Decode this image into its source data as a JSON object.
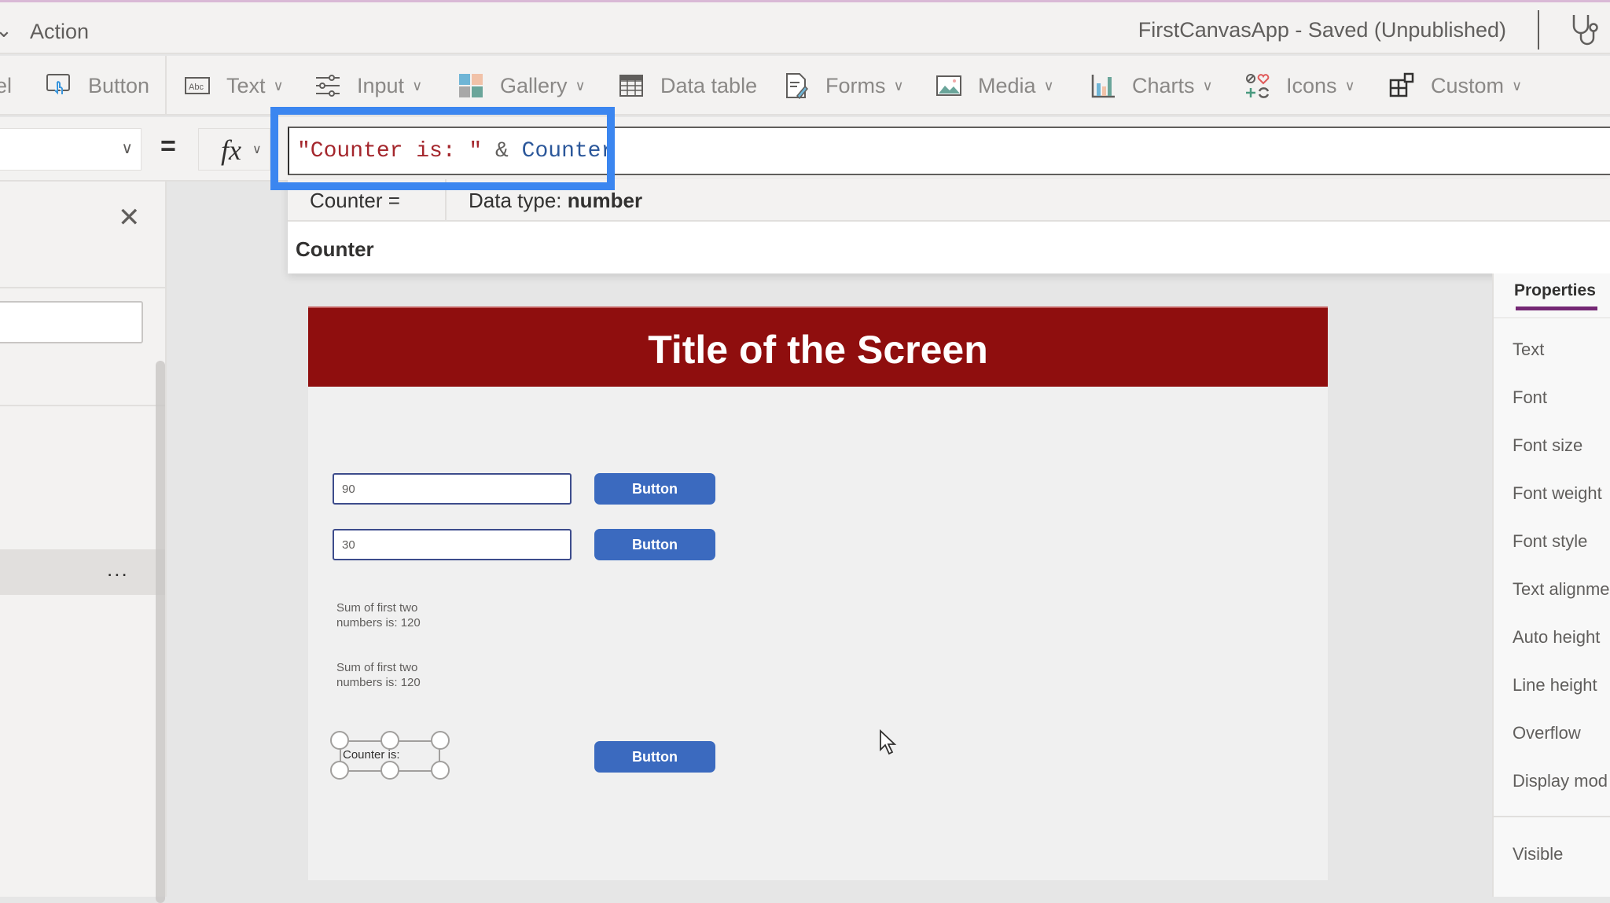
{
  "titlebar": {
    "menu_label": "Action",
    "app_status": "FirstCanvasApp - Saved (Unpublished)",
    "app_checker_icon": "stethoscope-icon"
  },
  "toolbar": {
    "items": [
      {
        "label": "el",
        "icon": "label-icon",
        "has_chevron": false
      },
      {
        "label": "Button",
        "icon": "button-icon",
        "has_chevron": false
      },
      {
        "label": "Text",
        "icon": "text-abc-icon",
        "has_chevron": true
      },
      {
        "label": "Input",
        "icon": "sliders-icon",
        "has_chevron": true
      },
      {
        "label": "Gallery",
        "icon": "gallery-icon",
        "has_chevron": true
      },
      {
        "label": "Data table",
        "icon": "table-icon",
        "has_chevron": false
      },
      {
        "label": "Forms",
        "icon": "form-icon",
        "has_chevron": true
      },
      {
        "label": "Media",
        "icon": "image-icon",
        "has_chevron": true
      },
      {
        "label": "Charts",
        "icon": "chart-icon",
        "has_chevron": true
      },
      {
        "label": "Icons",
        "icon": "icons-icon",
        "has_chevron": true
      },
      {
        "label": "Custom",
        "icon": "custom-component-icon",
        "has_chevron": true
      }
    ]
  },
  "formula_bar": {
    "property_value": "",
    "equals": "=",
    "fx_label": "fx",
    "formula": {
      "string_part": "\"Counter is: \"",
      "operator": " & ",
      "identifier": "Counter"
    }
  },
  "autocomplete": {
    "name": "Counter  =",
    "data_type_label": "Data type: ",
    "data_type_value": "number",
    "suggestion": "Counter"
  },
  "left_pane": {
    "close_icon": "close-icon",
    "more_label": "..."
  },
  "canvas": {
    "header_title": "Title of the Screen",
    "header_color": "#8f0e0e",
    "inputs": [
      {
        "value": "90"
      },
      {
        "value": "30"
      }
    ],
    "buttons": [
      {
        "label": "Button"
      },
      {
        "label": "Button"
      },
      {
        "label": "Button"
      }
    ],
    "sum_labels": [
      {
        "line1": "Sum of first two",
        "line2": "numbers is: 120"
      },
      {
        "line1": "Sum of first two",
        "line2": "numbers is: 120"
      }
    ],
    "counter_label": "Counter is:",
    "button_color": "#3b6abf"
  },
  "right_pane": {
    "tab_label": "Properties",
    "properties": [
      "Text",
      "Font",
      "Font size",
      "Font weight",
      "Font style",
      "Text alignme",
      "Auto height",
      "Line height",
      "Overflow",
      "Display mod",
      "Visible"
    ]
  },
  "colors": {
    "highlight": "#3b86f0",
    "accent": "#742774"
  }
}
